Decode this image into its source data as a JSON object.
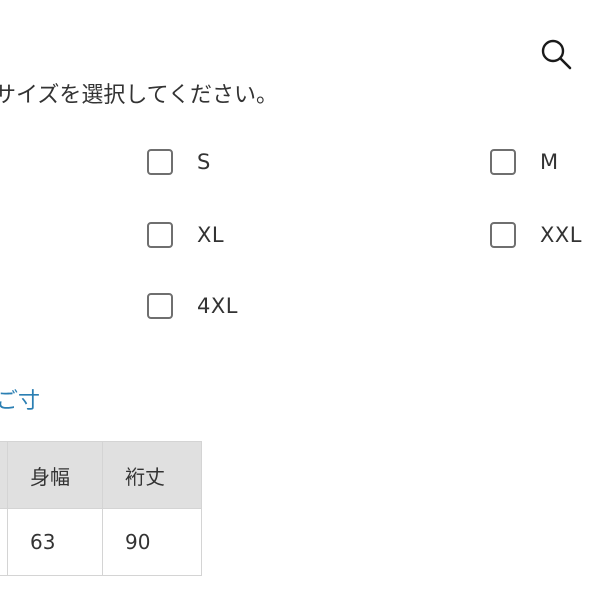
{
  "header": {
    "search_icon": "search-icon"
  },
  "instruction": {
    "text": "サイズを選択してください。"
  },
  "size_options": [
    {
      "label": "S"
    },
    {
      "label": "M"
    },
    {
      "label": "XL"
    },
    {
      "label": "XXL"
    },
    {
      "label": "4XL"
    }
  ],
  "size_chart_link": {
    "label": "ご寸"
  },
  "size_table": {
    "headers": [
      "",
      "身幅",
      "裄丈"
    ],
    "rows": [
      [
        "",
        "63",
        "90"
      ]
    ]
  },
  "colors": {
    "link": "#2b7fb3",
    "header_bg": "#e0e0e0",
    "checkbox_border": "#6f6f6f"
  }
}
